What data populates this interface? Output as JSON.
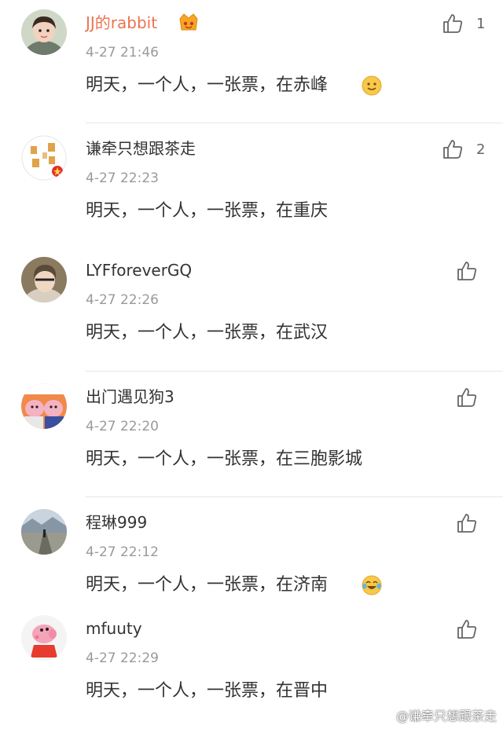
{
  "comments": [
    {
      "user": "JJ的rabbit",
      "time": "4-27 21:46",
      "text": "明天，一个人，一张票，在赤峰",
      "likes": "1",
      "avatar": "girl-avatar",
      "badge": "vip-crown-badge",
      "emoji": "smile-emoji"
    },
    {
      "user": "谦牵只想跟茶走",
      "time": "4-27 22:23",
      "text": "明天，一个人，一张票，在重庆",
      "likes": "2",
      "avatar": "text-calligraphy-avatar"
    },
    {
      "user": "LYFforeverGQ",
      "time": "4-27 22:26",
      "text": "明天，一个人，一张票，在武汉",
      "likes": "",
      "avatar": "person-avatar"
    },
    {
      "user": "出门遇见狗3",
      "time": "4-27 22:20",
      "text": "明天，一个人，一张票，在三胞影城",
      "likes": "",
      "avatar": "cartoon-pigs-avatar"
    },
    {
      "user": "程琳999",
      "time": "4-27 22:12",
      "text": "明天，一个人，一张票，在济南",
      "likes": "",
      "avatar": "road-landscape-avatar",
      "emoji": "laugh-tears-emoji"
    },
    {
      "user": "mfuuty",
      "time": "4-27 22:29",
      "text": "明天，一个人，一张票，在晋中",
      "likes": "",
      "avatar": "peppa-pig-avatar"
    }
  ],
  "watermark": {
    "text": "@谦牵只想跟茶走",
    "icon": "weibo-icon"
  },
  "colors": {
    "vip_name": "#eb7350",
    "name": "#333333",
    "time": "#9a9a9a",
    "divider": "#e6e6e6"
  }
}
